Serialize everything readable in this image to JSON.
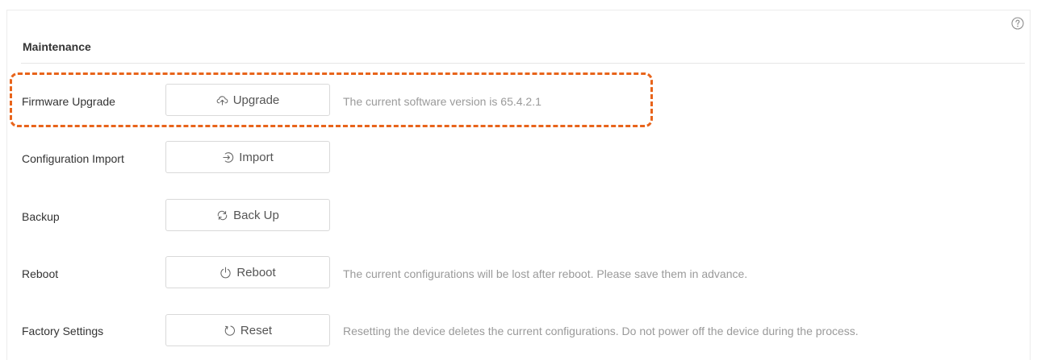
{
  "section": {
    "title": "Maintenance"
  },
  "help": {
    "icon": "help-circle-icon"
  },
  "highlight_color": "#e8641b",
  "rows": [
    {
      "label": "Firmware Upgrade",
      "button_label": "Upgrade",
      "button_icon": "cloud-upload-icon",
      "description": "The current software version is 65.4.2.1"
    },
    {
      "label": "Configuration Import",
      "button_label": "Import",
      "button_icon": "import-icon",
      "description": ""
    },
    {
      "label": "Backup",
      "button_label": "Back Up",
      "button_icon": "sync-icon",
      "description": ""
    },
    {
      "label": "Reboot",
      "button_label": "Reboot",
      "button_icon": "power-icon",
      "description": "The current configurations will be lost after reboot. Please save them in advance."
    },
    {
      "label": "Factory Settings",
      "button_label": "Reset",
      "button_icon": "reset-icon",
      "description": "Resetting the device deletes the current configurations. Do not power off the device during the process."
    }
  ]
}
